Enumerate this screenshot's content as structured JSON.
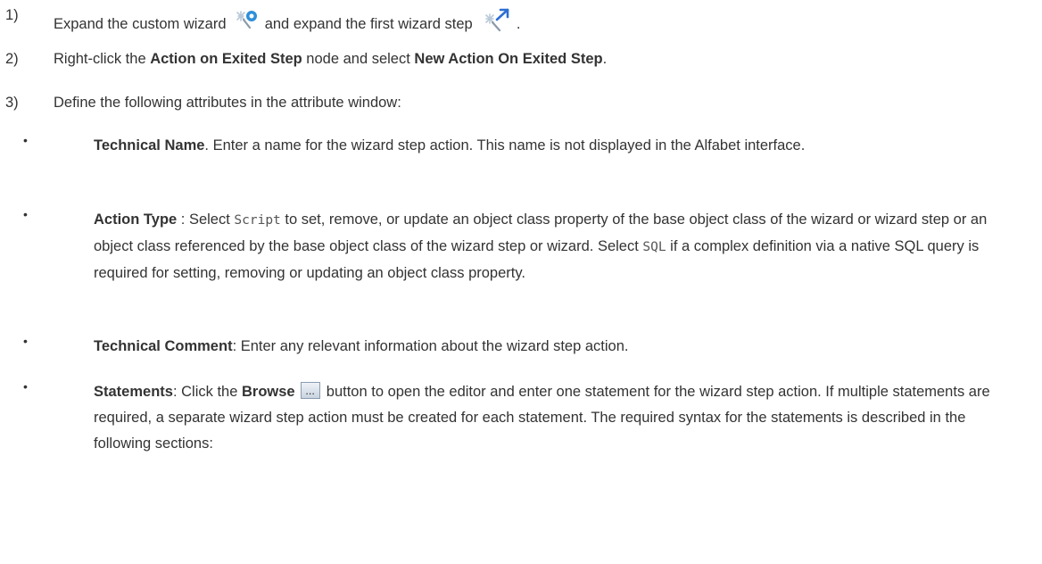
{
  "steps": [
    {
      "number": "1)",
      "text_before_icon1": "Expand the custom wizard",
      "icon1": "custom-wizard-icon",
      "text_between_icons": "and expand the first wizard step",
      "icon2": "wizard-step-icon",
      "text_after_icon2": "."
    },
    {
      "number": "2)",
      "text_1": "Right-click the ",
      "bold_1": "Action on Exited Step",
      "text_2": " node and select ",
      "bold_2": "New Action On Exited Step",
      "text_3": "."
    },
    {
      "number": "3)",
      "text": "Define the following attributes in the attribute window:"
    }
  ],
  "attributes": [
    {
      "bullet": "•",
      "name": "Technical Name",
      "text": ". Enter a name for the wizard step action. This name is not displayed in the Alfabet interface."
    },
    {
      "bullet": "•",
      "name": "Action Type",
      "text_1": " : Select ",
      "code_1": "Script",
      "text_2": " to set, remove, or update an object class property of the base object class of the wizard or wizard step or an object class referenced by the base object class of the wizard step or wizard. Select ",
      "code_2": "SQL",
      "text_3": " if a complex definition via a native SQL query is required for setting, removing or updating an object class property."
    },
    {
      "bullet": "•",
      "name": "Technical Comment",
      "text": ": Enter any relevant information about the wizard step action."
    },
    {
      "bullet": "•",
      "name": "Statements",
      "text_1": ": Click the ",
      "button_name": "Browse",
      "button_icon": "browse-button-icon",
      "button_glyph": "...",
      "text_2": " button to open the editor and enter one statement for the wizard step action. If multiple statements are required, a separate wizard step action must be created for each statement. The required syntax for the statements is described in the following sections:"
    }
  ]
}
